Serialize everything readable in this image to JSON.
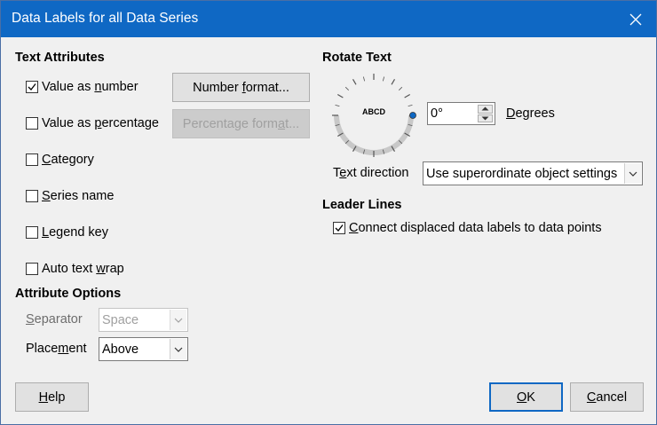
{
  "dialog": {
    "title": "Data Labels for all Data Series",
    "close_icon": "close-icon"
  },
  "text_attributes": {
    "heading": "Text Attributes",
    "value_as_number": {
      "label_pre": "Value as ",
      "label_u": "n",
      "label_post": "umber",
      "checked": true
    },
    "value_as_percentage": {
      "label_pre": "Value as ",
      "label_u": "p",
      "label_post": "ercentage",
      "checked": false
    },
    "category": {
      "label_pre": "",
      "label_u": "C",
      "label_post": "ategory",
      "checked": false
    },
    "series_name": {
      "label_pre": "",
      "label_u": "S",
      "label_post": "eries name",
      "checked": false
    },
    "legend_key": {
      "label_pre": "",
      "label_u": "L",
      "label_post": "egend key",
      "checked": false
    },
    "auto_text_wrap": {
      "label_pre": "Auto text ",
      "label_u": "w",
      "label_post": "rap",
      "checked": false
    },
    "number_format_button": {
      "pre": "Number ",
      "u": "f",
      "post": "ormat..."
    },
    "percentage_format_button": {
      "pre": "Percentage form",
      "u": "a",
      "post": "t..."
    }
  },
  "attribute_options": {
    "heading": "Attribute Options",
    "separator": {
      "label_u": "S",
      "label_post": "eparator",
      "value": "Space"
    },
    "placement": {
      "label_pre": "Place",
      "label_u": "m",
      "label_post": "ent",
      "value": "Above"
    }
  },
  "rotate_text": {
    "heading": "Rotate Text",
    "dial_text": "ABCD",
    "degrees_value": "0°",
    "degrees_label_u": "D",
    "degrees_label_post": "egrees",
    "text_direction": {
      "label_pre": "T",
      "label_u": "e",
      "label_post": "xt direction",
      "value": "Use superordinate object settings"
    }
  },
  "leader_lines": {
    "heading": "Leader Lines",
    "connect": {
      "label_u": "C",
      "label_post": "onnect displaced data labels to data points",
      "checked": true
    }
  },
  "buttons": {
    "help": {
      "u": "H",
      "post": "elp"
    },
    "ok": {
      "u": "O",
      "post": "K"
    },
    "cancel": {
      "u": "C",
      "post": "ancel"
    }
  }
}
